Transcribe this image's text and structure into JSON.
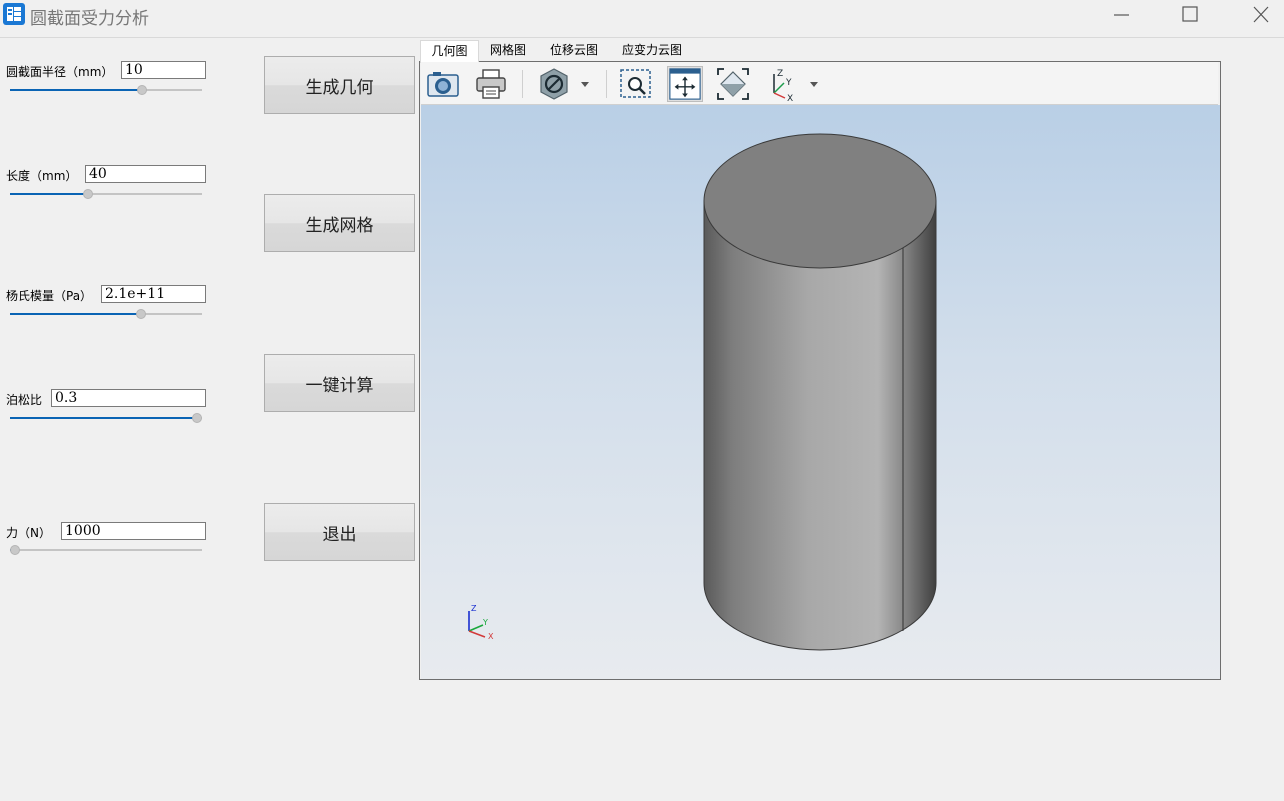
{
  "window": {
    "title": "圆截面受力分析"
  },
  "params": [
    {
      "label": "圆截面半径（mm）",
      "value": "10",
      "slider": 0.7
    },
    {
      "label": "长度（mm）",
      "value": "40",
      "slider": 0.4
    },
    {
      "label": "杨氏模量（Pa）",
      "value": "2.1e+11",
      "slider": 0.69
    },
    {
      "label": "泊松比",
      "value": "0.3",
      "slider": 1.0
    },
    {
      "label": "力（N）",
      "value": "1000",
      "slider": 0.0
    }
  ],
  "buttons": {
    "geometry": "生成几何",
    "mesh": "生成网格",
    "compute": "一键计算",
    "exit": "退出"
  },
  "tabs": [
    "几何图",
    "网格图",
    "位移云图",
    "应变力云图"
  ],
  "active_tab": "几何图",
  "toolbar_icons": [
    "camera-icon",
    "printer-icon",
    "section-icon",
    "zoom-box-icon",
    "pan-icon",
    "fit-view-icon",
    "axis-view-icon"
  ],
  "triad": {
    "z": "Z",
    "y": "Y",
    "x": "X"
  },
  "colors": {
    "accent": "#0a64b4",
    "canvas_top": "#b9cfe6",
    "canvas_bottom": "#e8ebef",
    "model_gray": "#8a8a8a"
  }
}
